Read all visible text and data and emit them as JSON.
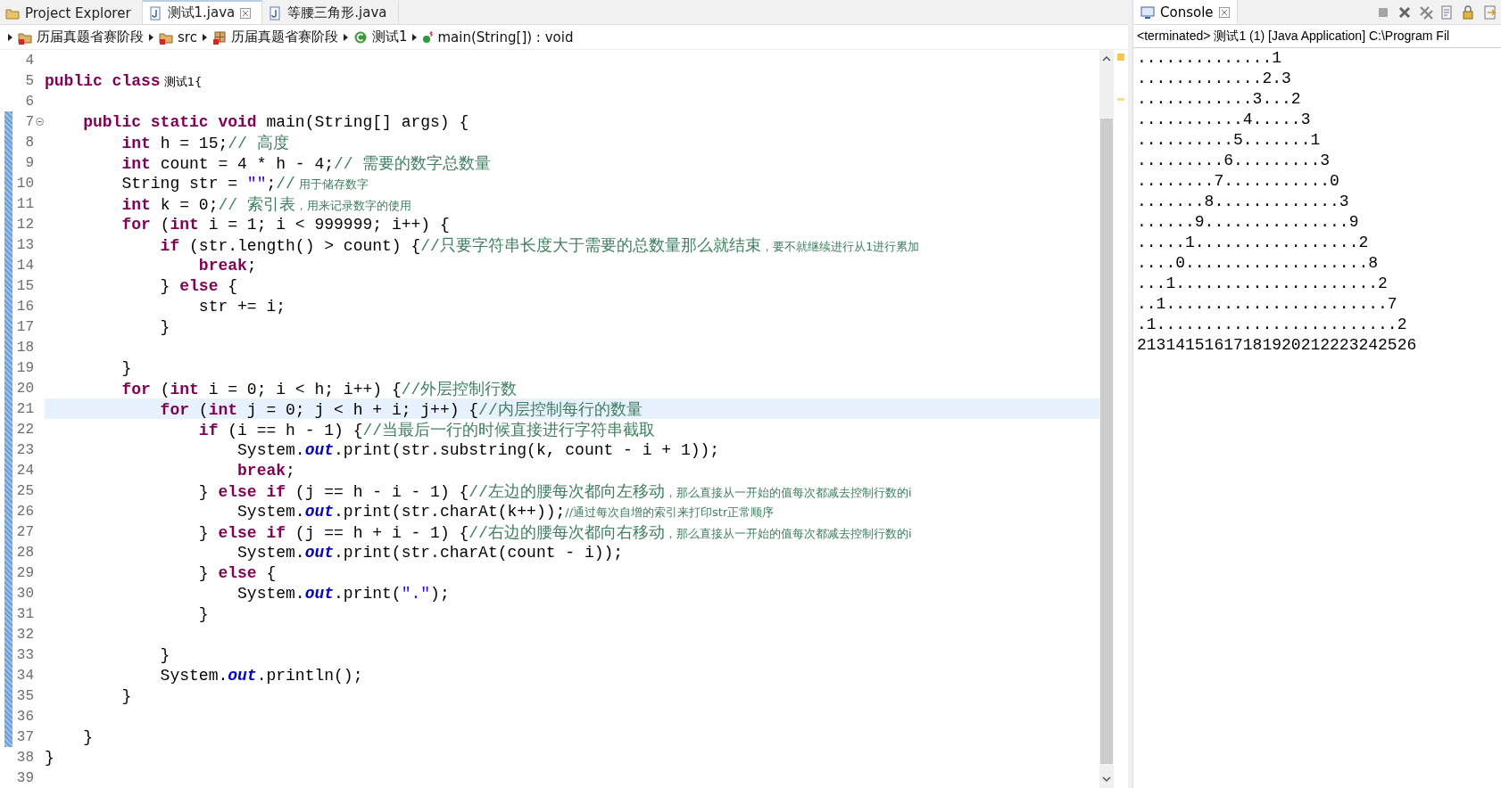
{
  "tabs": [
    {
      "label": "Project Explorer",
      "kind": "view",
      "selected": false,
      "closable": false
    },
    {
      "label": "测试1.java",
      "kind": "file",
      "selected": true,
      "closable": true
    },
    {
      "label": "等腰三角形.java",
      "kind": "file",
      "selected": false,
      "closable": false
    }
  ],
  "breadcrumb": [
    {
      "label": "历届真题省赛阶段",
      "kind": "project"
    },
    {
      "label": "src",
      "kind": "source-folder"
    },
    {
      "label": "历届真题省赛阶段",
      "kind": "package"
    },
    {
      "label": "测试1",
      "kind": "class"
    },
    {
      "label": "main(String[]) : void",
      "kind": "method"
    }
  ],
  "editor": {
    "lines": [
      {
        "number": "4",
        "current": false,
        "changed": false,
        "foldable": false
      },
      {
        "number": "5",
        "current": false,
        "changed": false,
        "foldable": false,
        "tokens": [
          {
            "kind": "keyword",
            "text": "public class"
          },
          {
            "kind": "plain-small",
            "text": " 测试1{"
          }
        ]
      },
      {
        "number": "6",
        "current": false,
        "changed": false,
        "foldable": false
      },
      {
        "number": "7",
        "current": false,
        "changed": true,
        "foldable": true,
        "tokens": [
          {
            "kind": "keyword",
            "text": "    public static void"
          },
          {
            "kind": "plain",
            "text": " main(String[] args) {"
          }
        ]
      },
      {
        "number": "8",
        "current": false,
        "changed": true,
        "foldable": false,
        "tokens": [
          {
            "kind": "keyword",
            "text": "        int"
          },
          {
            "kind": "plain",
            "text": " h = 15;"
          },
          {
            "kind": "comment",
            "text": "// 高度"
          }
        ]
      },
      {
        "number": "9",
        "current": false,
        "changed": true,
        "foldable": false,
        "tokens": [
          {
            "kind": "keyword",
            "text": "        int"
          },
          {
            "kind": "plain",
            "text": " count = 4 * h - 4;"
          },
          {
            "kind": "comment",
            "text": "// 需要的数字总数量"
          }
        ]
      },
      {
        "number": "10",
        "current": false,
        "changed": true,
        "foldable": false,
        "tokens": [
          {
            "kind": "plain",
            "text": "        String str = "
          },
          {
            "kind": "string",
            "text": "\"\""
          },
          {
            "kind": "plain",
            "text": ";"
          },
          {
            "kind": "comment",
            "text": "//"
          },
          {
            "kind": "comment-small",
            "text": " 用于储存数字"
          }
        ]
      },
      {
        "number": "11",
        "current": false,
        "changed": true,
        "foldable": false,
        "tokens": [
          {
            "kind": "keyword",
            "text": "        int"
          },
          {
            "kind": "plain",
            "text": " k = 0;"
          },
          {
            "kind": "comment",
            "text": "// 索引表"
          },
          {
            "kind": "comment-small",
            "text": "，用来记录数字的使用"
          }
        ]
      },
      {
        "number": "12",
        "current": false,
        "changed": true,
        "foldable": false,
        "tokens": [
          {
            "kind": "keyword",
            "text": "        for"
          },
          {
            "kind": "plain",
            "text": " ("
          },
          {
            "kind": "keyword",
            "text": "int"
          },
          {
            "kind": "plain",
            "text": " i = 1; i < 999999; i++) {"
          }
        ]
      },
      {
        "number": "13",
        "current": false,
        "changed": true,
        "foldable": false,
        "tokens": [
          {
            "kind": "keyword",
            "text": "            if"
          },
          {
            "kind": "plain",
            "text": " (str.length() > count) {"
          },
          {
            "kind": "comment",
            "text": "//只要字符串长度大于需要的总数量那么就结束"
          },
          {
            "kind": "comment-small",
            "text": "，要不就继续进行从1进行累加"
          }
        ]
      },
      {
        "number": "14",
        "current": false,
        "changed": true,
        "foldable": false,
        "tokens": [
          {
            "kind": "keyword",
            "text": "                break"
          },
          {
            "kind": "plain",
            "text": ";"
          }
        ]
      },
      {
        "number": "15",
        "current": false,
        "changed": true,
        "foldable": false,
        "tokens": [
          {
            "kind": "plain",
            "text": "            } "
          },
          {
            "kind": "keyword",
            "text": "else"
          },
          {
            "kind": "plain",
            "text": " {"
          }
        ]
      },
      {
        "number": "16",
        "current": false,
        "changed": true,
        "foldable": false,
        "tokens": [
          {
            "kind": "plain",
            "text": "                str += i;"
          }
        ]
      },
      {
        "number": "17",
        "current": false,
        "changed": true,
        "foldable": false,
        "tokens": [
          {
            "kind": "plain",
            "text": "            }"
          }
        ]
      },
      {
        "number": "18",
        "current": false,
        "changed": true,
        "foldable": false
      },
      {
        "number": "19",
        "current": false,
        "changed": true,
        "foldable": false,
        "tokens": [
          {
            "kind": "plain",
            "text": "        }"
          }
        ]
      },
      {
        "number": "20",
        "current": false,
        "changed": true,
        "foldable": false,
        "tokens": [
          {
            "kind": "keyword",
            "text": "        for"
          },
          {
            "kind": "plain",
            "text": " ("
          },
          {
            "kind": "keyword",
            "text": "int"
          },
          {
            "kind": "plain",
            "text": " i = 0; i < h; i++) {"
          },
          {
            "kind": "comment",
            "text": "//外层控制行数"
          }
        ]
      },
      {
        "number": "21",
        "current": true,
        "changed": true,
        "foldable": false,
        "tokens": [
          {
            "kind": "keyword",
            "text": "            for"
          },
          {
            "kind": "plain",
            "text": " ("
          },
          {
            "kind": "keyword",
            "text": "int"
          },
          {
            "kind": "plain",
            "text": " j = 0; j < h + i; j++) {"
          },
          {
            "kind": "comment",
            "text": "//内层控制每行的数量"
          }
        ]
      },
      {
        "number": "22",
        "current": false,
        "changed": true,
        "foldable": false,
        "tokens": [
          {
            "kind": "keyword",
            "text": "                if"
          },
          {
            "kind": "plain",
            "text": " (i == h - 1) {"
          },
          {
            "kind": "comment",
            "text": "//当最后一行的时候直接进行字符串截取"
          }
        ]
      },
      {
        "number": "23",
        "current": false,
        "changed": true,
        "foldable": false,
        "tokens": [
          {
            "kind": "plain",
            "text": "                    System."
          },
          {
            "kind": "field",
            "text": "out"
          },
          {
            "kind": "plain",
            "text": ".print(str.substring(k, count - i + 1));"
          }
        ]
      },
      {
        "number": "24",
        "current": false,
        "changed": true,
        "foldable": false,
        "tokens": [
          {
            "kind": "keyword",
            "text": "                    break"
          },
          {
            "kind": "plain",
            "text": ";"
          }
        ]
      },
      {
        "number": "25",
        "current": false,
        "changed": true,
        "foldable": false,
        "tokens": [
          {
            "kind": "plain",
            "text": "                } "
          },
          {
            "kind": "keyword",
            "text": "else if"
          },
          {
            "kind": "plain",
            "text": " (j == h - i - 1) {"
          },
          {
            "kind": "comment",
            "text": "//左边的腰每次都向左移动"
          },
          {
            "kind": "comment-small",
            "text": "，那么直接从一开始的值每次都减去控制行数的i"
          }
        ]
      },
      {
        "number": "26",
        "current": false,
        "changed": true,
        "foldable": false,
        "tokens": [
          {
            "kind": "plain",
            "text": "                    System."
          },
          {
            "kind": "field",
            "text": "out"
          },
          {
            "kind": "plain",
            "text": ".print(str.charAt(k++));"
          },
          {
            "kind": "comment-small",
            "text": "//通过每次自增的索引来打印str正常顺序"
          }
        ]
      },
      {
        "number": "27",
        "current": false,
        "changed": true,
        "foldable": false,
        "tokens": [
          {
            "kind": "plain",
            "text": "                } "
          },
          {
            "kind": "keyword",
            "text": "else if"
          },
          {
            "kind": "plain",
            "text": " (j == h + i - 1) {"
          },
          {
            "kind": "comment",
            "text": "//右边的腰每次都向右移动"
          },
          {
            "kind": "comment-small",
            "text": "，那么直接从一开始的值每次都减去控制行数的i"
          }
        ]
      },
      {
        "number": "28",
        "current": false,
        "changed": true,
        "foldable": false,
        "tokens": [
          {
            "kind": "plain",
            "text": "                    System."
          },
          {
            "kind": "field",
            "text": "out"
          },
          {
            "kind": "plain",
            "text": ".print(str.charAt(count - i));"
          }
        ]
      },
      {
        "number": "29",
        "current": false,
        "changed": true,
        "foldable": false,
        "tokens": [
          {
            "kind": "plain",
            "text": "                } "
          },
          {
            "kind": "keyword",
            "text": "else"
          },
          {
            "kind": "plain",
            "text": " {"
          }
        ]
      },
      {
        "number": "30",
        "current": false,
        "changed": true,
        "foldable": false,
        "tokens": [
          {
            "kind": "plain",
            "text": "                    System."
          },
          {
            "kind": "field",
            "text": "out"
          },
          {
            "kind": "plain",
            "text": ".print("
          },
          {
            "kind": "string",
            "text": "\".\""
          },
          {
            "kind": "plain",
            "text": ");"
          }
        ]
      },
      {
        "number": "31",
        "current": false,
        "changed": true,
        "foldable": false,
        "tokens": [
          {
            "kind": "plain",
            "text": "                }"
          }
        ]
      },
      {
        "number": "32",
        "current": false,
        "changed": true,
        "foldable": false
      },
      {
        "number": "33",
        "current": false,
        "changed": true,
        "foldable": false,
        "tokens": [
          {
            "kind": "plain",
            "text": "            }"
          }
        ]
      },
      {
        "number": "34",
        "current": false,
        "changed": true,
        "foldable": false,
        "tokens": [
          {
            "kind": "plain",
            "text": "            System."
          },
          {
            "kind": "field",
            "text": "out"
          },
          {
            "kind": "plain",
            "text": ".println();"
          }
        ]
      },
      {
        "number": "35",
        "current": false,
        "changed": true,
        "foldable": false,
        "tokens": [
          {
            "kind": "plain",
            "text": "        }"
          }
        ]
      },
      {
        "number": "36",
        "current": false,
        "changed": true,
        "foldable": false
      },
      {
        "number": "37",
        "current": false,
        "changed": true,
        "foldable": false,
        "tokens": [
          {
            "kind": "plain",
            "text": "    }"
          }
        ]
      },
      {
        "number": "38",
        "current": false,
        "changed": false,
        "foldable": false,
        "tokens": [
          {
            "kind": "plain",
            "text": "}"
          }
        ]
      },
      {
        "number": "39",
        "current": false,
        "changed": false,
        "foldable": false
      }
    ]
  },
  "console": {
    "title": "Console",
    "status": "<terminated> 测试1 (1) [Java Application] C:\\Program Fil",
    "output": [
      "..............1",
      ".............2.3",
      "............3...2",
      "...........4.....3",
      "..........5.......1",
      ".........6.........3",
      "........7...........0",
      ".......8.............3",
      "......9...............9",
      ".....1.................2",
      "....0...................8",
      "...1.....................2",
      "..1.......................7",
      ".1.........................2",
      "21314151617181920212223242526"
    ]
  }
}
